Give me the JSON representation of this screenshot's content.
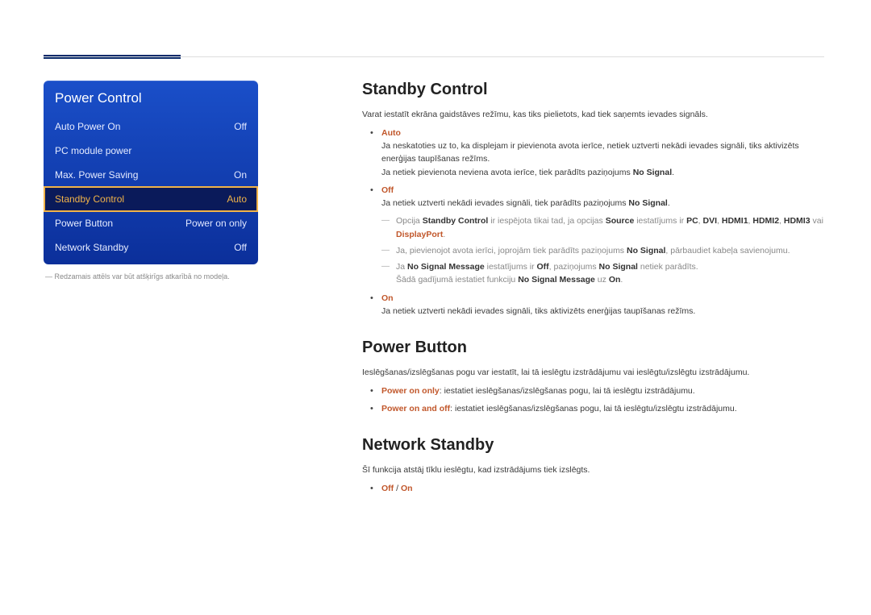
{
  "osd": {
    "title": "Power Control",
    "rows": [
      {
        "label": "Auto Power On",
        "value": "Off"
      },
      {
        "label": "PC module power",
        "value": ""
      },
      {
        "label": "Max. Power Saving",
        "value": "On"
      },
      {
        "label": "Standby Control",
        "value": "Auto",
        "selected": true
      },
      {
        "label": "Power Button",
        "value": "Power on only"
      },
      {
        "label": "Network Standby",
        "value": "Off"
      }
    ],
    "note": "―  Redzamais attēls var būt atšķirīgs atkarībā no modeļa."
  },
  "standby": {
    "heading": "Standby Control",
    "intro": "Varat iestatīt ekrāna gaidstāves režīmu, kas tiks pielietots, kad tiek saņemts ievades signāls.",
    "auto_label": "Auto",
    "auto_p1": "Ja neskatoties uz to, ka displejam ir pievienota avota ierīce, netiek uztverti nekādi ievades signāli, tiks aktivizēts enerģijas taupīšanas režīms.",
    "auto_p2_pre": "Ja netiek pievienota neviena avota ierīce, tiek parādīts paziņojums ",
    "auto_p2_ns": "No Signal",
    "off_label": "Off",
    "off_p_pre": "Ja netiek uztverti nekādi ievades signāli, tiek parādīts paziņojums ",
    "off_p_ns": "No Signal",
    "sub1_pre": "Opcija ",
    "sub1_sc": "Standby Control",
    "sub1_mid": " ir iespējota tikai tad, ja opcijas ",
    "sub1_source": "Source",
    "sub1_mid2": " iestatījums ir ",
    "sub1_pc": "PC",
    "sub1_dvi": "DVI",
    "sub1_h1": "HDMI1",
    "sub1_h2": "HDMI2",
    "sub1_h3": "HDMI3",
    "sub1_or": " vai ",
    "sub1_dp": "DisplayPort",
    "sub2_pre": "Ja, pievienojot avota ierīci, joprojām tiek parādīts paziņojums ",
    "sub2_ns": "No Signal",
    "sub2_post": ", pārbaudiet kabeļa savienojumu.",
    "sub3_pre": "Ja ",
    "sub3_nsm": "No Signal Message",
    "sub3_mid": " iestatījums ir ",
    "sub3_off": "Off",
    "sub3_mid2": ", paziņojums ",
    "sub3_ns": "No Signal",
    "sub3_post": " netiek parādīts.",
    "sub3_line2_pre": "Šādā gadījumā iestatiet funkciju ",
    "sub3_line2_nsm": "No Signal Message",
    "sub3_line2_mid": " uz ",
    "sub3_line2_on": "On",
    "on_label": "On",
    "on_p": "Ja netiek uztverti nekādi ievades signāli, tiks aktivizēts enerģijas taupīšanas režīms."
  },
  "powerbtn": {
    "heading": "Power Button",
    "intro": "Ieslēgšanas/izslēgšanas pogu var iestatīt, lai tā ieslēgtu izstrādājumu vai ieslēgtu/izslēgtu izstrādājumu.",
    "opt1_name": "Power on only",
    "opt1_text": ": iestatiet ieslēgšanas/izslēgšanas pogu, lai tā ieslēgtu izstrādājumu.",
    "opt2_name": "Power on and off",
    "opt2_text": ": iestatiet ieslēgšanas/izslēgšanas pogu, lai tā ieslēgtu/izslēgtu izstrādājumu."
  },
  "netstandby": {
    "heading": "Network Standby",
    "intro": "Šī funkcija atstāj tīklu ieslēgtu, kad izstrādājums tiek izslēgts.",
    "opt_off": "Off",
    "opt_sep": " / ",
    "opt_on": "On"
  }
}
